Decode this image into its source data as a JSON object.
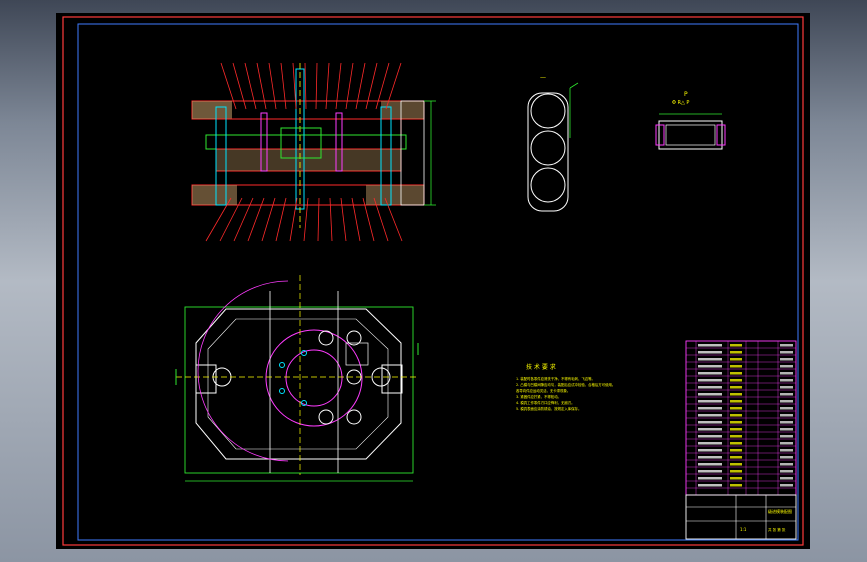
{
  "colors": {
    "background": "#000000",
    "frame": "#ff3b3b",
    "inner_frame": "#3f7dff",
    "cyan": "#00e5ff",
    "green": "#2fe82f",
    "yellow": "#ffff00",
    "red": "#ff2a2a",
    "magenta": "#ff3cff",
    "white": "#ffffff",
    "orange": "#ffaa00"
  },
  "views": {
    "section_label": "A-A",
    "part_view_label": "P",
    "part_view_caption": "Φ R△ P",
    "strip_label": "—"
  },
  "tech_requirements": {
    "title": "技 术 要 求",
    "lines": [
      "1. 装配时各零件应清洗干净，不得有毛刺、飞边等。",
      "2. 凸模与凹模间隙应均匀，装配后应试冲检验，合格后方可使用。",
      "   各导向件应运动灵活，无卡滞现象。",
      "3. 紧固件应拧紧，不得松动。",
      "4. 模具工作零件刃口应锋利，无崩刃。",
      "5. 模具表面应涂防锈油，按规定入库保存。"
    ]
  },
  "title_block": {
    "drawing_name": "级进模装配图",
    "scale": "1:1",
    "sheet": "共 张 第 张"
  }
}
